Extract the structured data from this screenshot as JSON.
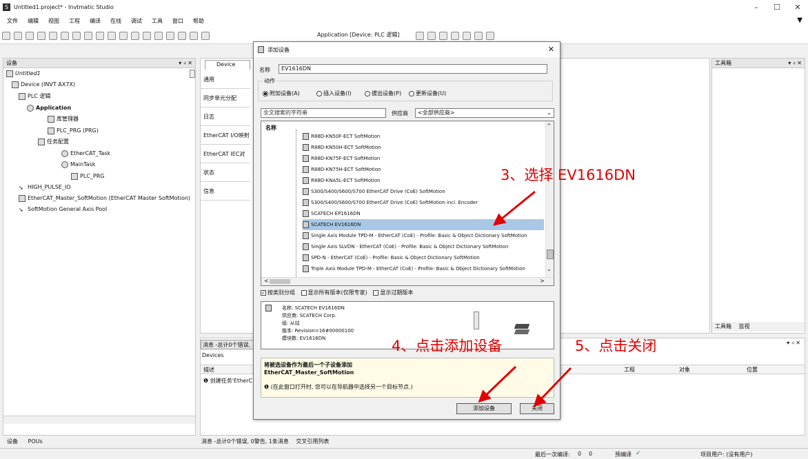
{
  "window": {
    "title": "Untitled1.project* - Invtmatic Studio",
    "app_icon": "S",
    "controls": [
      "–",
      "☐",
      "✕"
    ],
    "pin_arrow": "▼"
  },
  "menu": [
    "文件",
    "编辑",
    "视图",
    "工程",
    "编译",
    "在线",
    "调试",
    "工具",
    "窗口",
    "帮助"
  ],
  "toolbar": {
    "application_label": "Application [Device: PLC 逻辑]"
  },
  "device_panel": {
    "title": "设备",
    "controls": "▾ ⫞ ✕",
    "tree": [
      {
        "label": "Untitled1",
        "italic": true
      },
      {
        "label": "Device (INVT AX7X)"
      },
      {
        "label": "PLC 逻辑"
      },
      {
        "label": "Application",
        "bold": true
      },
      {
        "label": "库管理器"
      },
      {
        "label": "PLC_PRG (PRG)"
      },
      {
        "label": "任务配置"
      },
      {
        "label": "EtherCAT_Task"
      },
      {
        "label": "MainTask"
      },
      {
        "label": "PLC_PRG"
      },
      {
        "label": "HIGH_PULSE_IO"
      },
      {
        "label": "EtherCAT_Master_SoftMotion (EtherCAT Master SoftMotion)"
      },
      {
        "label": "SoftMotion General Axis Pool"
      }
    ],
    "bottom_tabs": [
      "设备",
      "POUs"
    ]
  },
  "editor": {
    "tab_label": "Device",
    "side_tabs": [
      "通用",
      "同步单元分配",
      "日志",
      "EtherCAT I/O映射",
      "EtherCAT IEC对象",
      "状态",
      "信息"
    ]
  },
  "toolbox": {
    "title": "工具箱",
    "controls": "▾ ⫞ ✕",
    "bottom_tabs": [
      "工具箱",
      "监视"
    ]
  },
  "messages": {
    "header_tab": "消息 -总计0个错误,",
    "devices_label": "Devices",
    "col_desc": "描述",
    "col_project": "工程",
    "col_object": "对象",
    "col_position": "位置",
    "row_text": "创建任务'EtherC",
    "controls": "▾ ⫞ ✕"
  },
  "bottom_bar": {
    "msg_tab": "消息 -总计0个错误, 0警告, 1条消息",
    "xref_tab": "交叉引用列表"
  },
  "status_bar": {
    "last_compile": "最后一次编译:",
    "c_err": "0",
    "c_warn": "0",
    "precompile": "预编译",
    "precompile_mark": "✓",
    "project_user": "项目用户: (没有用户)"
  },
  "dialog": {
    "title": "添加设备",
    "close_glyph": "✕",
    "name_label": "名称",
    "name_value": "EV1616DN",
    "action_group": "动作",
    "radios": [
      {
        "label": "附加设备(A)",
        "checked": true
      },
      {
        "label": "插入设备(I)",
        "checked": false
      },
      {
        "label": "拔出设备(P)",
        "checked": false
      },
      {
        "label": "更新设备(U)",
        "checked": false
      }
    ],
    "search_placeholder": "全文搜索的字符串",
    "vendor_label": "供应商",
    "vendor_value": "<全部供应商>",
    "list_header": "名称",
    "devices": [
      {
        "label": "R88D-KN50F-ECT SoftMotion",
        "selected": false
      },
      {
        "label": "R88D-KN50H-ECT SoftMotion",
        "selected": false
      },
      {
        "label": "R88D-KN75F-ECT SoftMotion",
        "selected": false
      },
      {
        "label": "R88D-KN75H-ECT SoftMotion",
        "selected": false
      },
      {
        "label": "R88D-KNA5L-ECT SoftMotion",
        "selected": false
      },
      {
        "label": "S300/S400/S600/S700 EtherCAT Drive (CoE) SoftMotion",
        "selected": false
      },
      {
        "label": "S300/S400/S600/S700 EtherCAT Drive (CoE) SoftMotion incl. Encoder",
        "selected": false
      },
      {
        "label": "SCATECH EP1616DN",
        "selected": false
      },
      {
        "label": "SCATECH EV1616DN",
        "selected": true
      },
      {
        "label": "Single Axis  Module TPD-M - EtherCAT (CoE) - Profile: Basic & Object Dictionary SoftMotion",
        "selected": false
      },
      {
        "label": "Single Axis  SLVDN - EtherCAT (CoE) - Profile: Basic & Object Dictionary SoftMotion",
        "selected": false
      },
      {
        "label": "SPD-N  - EtherCAT (CoE) - Profile: Basic & Object Dictionary SoftMotion",
        "selected": false
      },
      {
        "label": "Triple Axis  Module TPD-M - EtherCAT (CoE) - Profile: Basic & Object Dictionary SoftMotion",
        "selected": false
      }
    ],
    "options": [
      {
        "label": "按类别分组",
        "checked": true
      },
      {
        "label": "显示所有版本(仅限专家)",
        "checked": false
      },
      {
        "label": "显示过期版本",
        "checked": false
      }
    ],
    "info": {
      "name": "名称: SCATECH EV1616DN",
      "vendor": "供应商: SCATECH Corp.",
      "group": "组: 从站",
      "version": "版本: Revision=16#00000100",
      "model": "模块数: EV1616DN"
    },
    "hint_title": "将被选设备作为最后一个子设备添加",
    "hint_sub": "EtherCAT_Master_SoftMotion",
    "hint_note": "(在此窗口打开时, 您可以在导航器中选择另一个目标节点.)",
    "add_button": "添加设备",
    "close_button": "关闭"
  },
  "annotations": {
    "step3": "3、选择 EV1616DN",
    "step4": "4、点击添加设备",
    "step5": "5、点击关闭",
    "color": "#e00000"
  }
}
